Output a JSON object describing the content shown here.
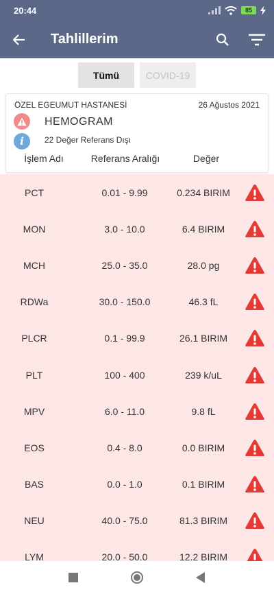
{
  "status_bar": {
    "time": "20:44",
    "battery": "85"
  },
  "app_bar": {
    "title": "Tahlillerim"
  },
  "tabs": [
    {
      "label": "Tümü",
      "active": true
    },
    {
      "label": "COVID-19",
      "active": false
    }
  ],
  "card": {
    "hospital": "ÖZEL EGEUMUT HASTANESİ",
    "date": "26 Ağustos 2021",
    "test_name": "HEMOGRAM",
    "subtitle": "22 Değer Referans Dışı",
    "headers": {
      "name": "İşlem Adı",
      "range": "Referans Aralığı",
      "value": "Değer"
    }
  },
  "colors": {
    "app_bar": "#5b6887",
    "row_bg": "#fde6e6",
    "warning": "#e53935",
    "info": "#6fa8dc",
    "alert": "#f28b8b"
  },
  "results": [
    {
      "name": "PCT",
      "range": "0.01 - 9.99",
      "value": "0.234 BIRIM"
    },
    {
      "name": "MON",
      "range": "3.0 - 10.0",
      "value": "6.4 BIRIM"
    },
    {
      "name": "MCH",
      "range": "25.0 - 35.0",
      "value": "28.0 pg"
    },
    {
      "name": "RDWa",
      "range": "30.0 - 150.0",
      "value": "46.3 fL"
    },
    {
      "name": "PLCR",
      "range": "0.1 - 99.9",
      "value": "26.1 BIRIM"
    },
    {
      "name": "PLT",
      "range": "100 - 400",
      "value": "239 k/uL"
    },
    {
      "name": "MPV",
      "range": "6.0 - 11.0",
      "value": "9.8 fL"
    },
    {
      "name": "EOS",
      "range": "0.4 - 8.0",
      "value": "0.0 BIRIM"
    },
    {
      "name": "BAS",
      "range": "0.0 - 1.0",
      "value": "0.1 BIRIM"
    },
    {
      "name": "NEU",
      "range": "40.0 - 75.0",
      "value": "81.3 BIRIM"
    },
    {
      "name": "LYM",
      "range": "20.0 - 50.0",
      "value": "12.2 BIRIM"
    }
  ]
}
